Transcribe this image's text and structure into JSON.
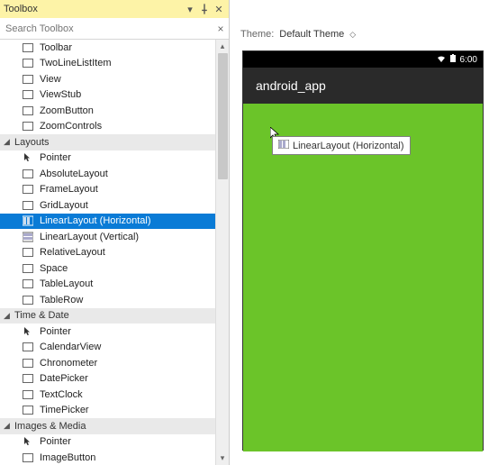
{
  "toolbox": {
    "title": "Toolbox",
    "search_placeholder": "Search Toolbox",
    "items_pre": [
      {
        "label": "Toolbar"
      },
      {
        "label": "TwoLineListItem"
      },
      {
        "label": "View"
      },
      {
        "label": "ViewStub"
      },
      {
        "label": "ZoomButton"
      },
      {
        "label": "ZoomControls"
      }
    ],
    "cat_layouts": "Layouts",
    "layouts": [
      {
        "label": "Pointer",
        "icon": "pointer"
      },
      {
        "label": "AbsoluteLayout",
        "icon": "layout"
      },
      {
        "label": "FrameLayout",
        "icon": "layout"
      },
      {
        "label": "GridLayout",
        "icon": "layout"
      },
      {
        "label": "LinearLayout (Horizontal)",
        "icon": "hlayout",
        "selected": true
      },
      {
        "label": "LinearLayout (Vertical)",
        "icon": "vlayout"
      },
      {
        "label": "RelativeLayout",
        "icon": "layout"
      },
      {
        "label": "Space",
        "icon": "layout"
      },
      {
        "label": "TableLayout",
        "icon": "layout"
      },
      {
        "label": "TableRow",
        "icon": "layout"
      }
    ],
    "cat_time": "Time & Date",
    "time": [
      {
        "label": "Pointer",
        "icon": "pointer"
      },
      {
        "label": "CalendarView",
        "icon": "widget"
      },
      {
        "label": "Chronometer",
        "icon": "widget"
      },
      {
        "label": "DatePicker",
        "icon": "widget"
      },
      {
        "label": "TextClock",
        "icon": "widget"
      },
      {
        "label": "TimePicker",
        "icon": "widget"
      }
    ],
    "cat_images": "Images & Media",
    "images": [
      {
        "label": "Pointer",
        "icon": "pointer"
      },
      {
        "label": "ImageButton",
        "icon": "widget"
      }
    ]
  },
  "designer": {
    "theme_label": "Theme:",
    "theme_value": "Default Theme",
    "status_time": "6:00",
    "app_title": "android_app",
    "dragged_label": "LinearLayout (Horizontal)"
  }
}
